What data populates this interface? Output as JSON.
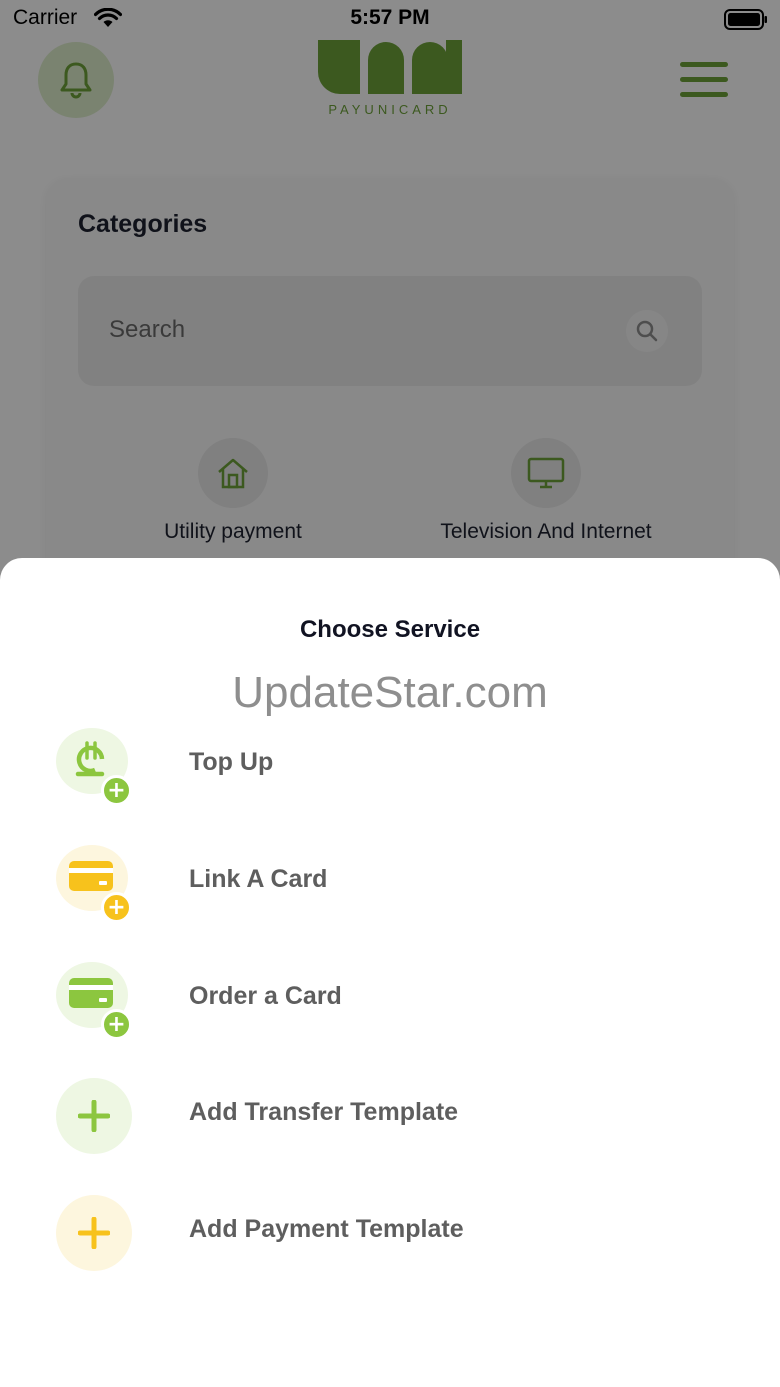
{
  "status_bar": {
    "carrier": "Carrier",
    "time": "5:57 PM"
  },
  "header": {
    "logo_text": "PAYUNICARD"
  },
  "categories": {
    "title": "Categories",
    "search_placeholder": "Search",
    "items": [
      {
        "label": "Utility payment",
        "icon": "house-icon"
      },
      {
        "label": "Television And Internet",
        "icon": "monitor-icon"
      }
    ]
  },
  "sheet": {
    "title": "Choose Service",
    "watermark": "UpdateStar.com",
    "services": [
      {
        "label": "Top Up",
        "icon": "lari-plus-icon",
        "color": "#8cc63f"
      },
      {
        "label": "Link A Card",
        "icon": "card-plus-icon",
        "color": "#f7c21c"
      },
      {
        "label": "Order a Card",
        "icon": "card-plus-icon",
        "color": "#8cc63f"
      },
      {
        "label": "Add Transfer Template",
        "icon": "plus-icon",
        "color": "#8cc63f"
      },
      {
        "label": "Add Payment Template",
        "icon": "plus-icon",
        "color": "#f7c21c"
      }
    ]
  },
  "colors": {
    "brand_green": "#6da33a",
    "accent_green": "#8cc63f",
    "accent_yellow": "#f7c21c"
  }
}
